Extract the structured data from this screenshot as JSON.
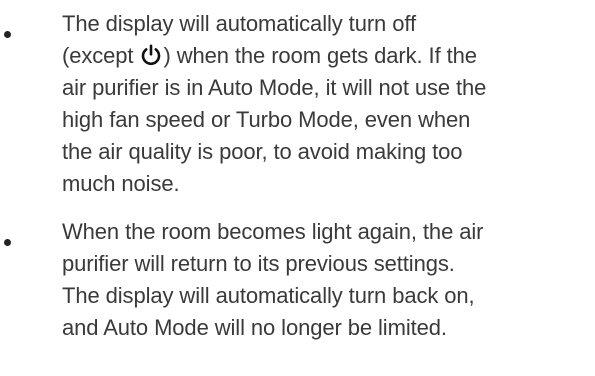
{
  "bullets": [
    {
      "lines": [
        "The display will automatically turn off",
        "(except",
        ") when the room gets dark. If the",
        "air purifier is in Auto Mode, it will not use the",
        "high fan speed or Turbo Mode, even when",
        "the air quality is poor, to avoid making too",
        "much noise."
      ],
      "icon": "power-icon"
    },
    {
      "lines": [
        "When the room becomes light again, the air",
        "purifier will return to its previous settings.",
        "The display will automatically turn back on,",
        "and Auto Mode will no longer be limited."
      ]
    }
  ]
}
